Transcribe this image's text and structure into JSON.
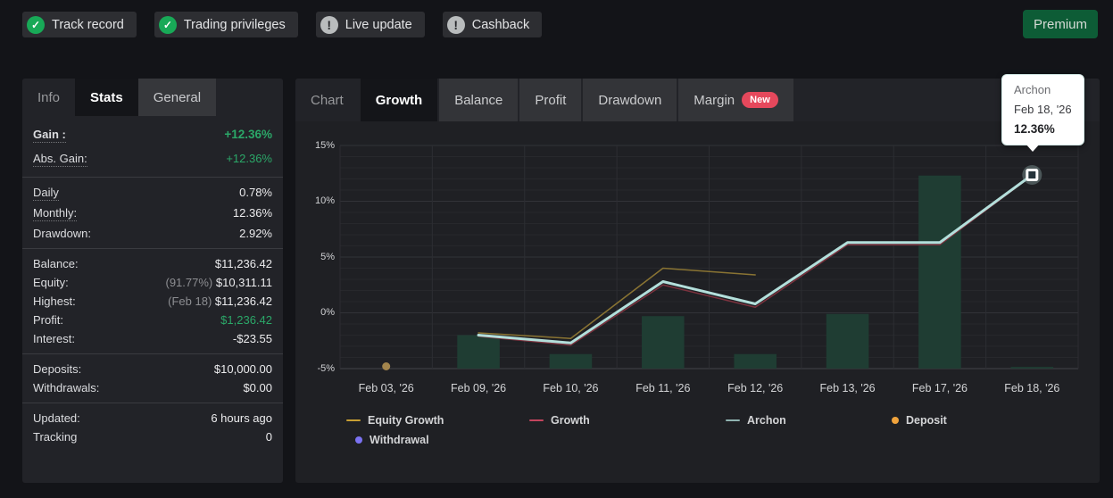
{
  "top_bar": {
    "badges": [
      {
        "label": "Track record",
        "icon": "check",
        "color": "#18a957"
      },
      {
        "label": "Trading privileges",
        "icon": "check",
        "color": "#18a957"
      },
      {
        "label": "Live update",
        "icon": "exclamation",
        "color": "#b9bcbd"
      },
      {
        "label": "Cashback",
        "icon": "exclamation",
        "color": "#b9bcbd"
      }
    ],
    "premium_label": "Premium"
  },
  "stats_panel": {
    "tabs": [
      {
        "label": "Info",
        "active": false
      },
      {
        "label": "Stats",
        "active": true
      },
      {
        "label": "General",
        "active": false,
        "alt": true
      }
    ],
    "groups": [
      {
        "rows": [
          {
            "label": "Gain :",
            "value": "+12.36%",
            "value_class": "green-bold",
            "dotted": true,
            "bold": true
          },
          {
            "label": "Abs. Gain:",
            "value": "+12.36%",
            "value_class": "green",
            "dotted": true
          }
        ]
      },
      {
        "rows": [
          {
            "label": "Daily",
            "value": "0.78%",
            "dotted": true
          },
          {
            "label": "Monthly:",
            "value": "12.36%",
            "dotted": true
          },
          {
            "label": "Drawdown:",
            "value": "2.92%"
          }
        ]
      },
      {
        "rows": [
          {
            "label": "Balance:",
            "value": "$11,236.42"
          },
          {
            "label": "Equity:",
            "value": "$10,311.11",
            "value_prefix": "(91.77%)"
          },
          {
            "label": "Highest:",
            "value": "$11,236.42",
            "value_prefix": "(Feb 18)"
          },
          {
            "label": "Profit:",
            "value": "$1,236.42",
            "value_class": "green"
          },
          {
            "label": "Interest:",
            "value": "-$23.55"
          }
        ]
      },
      {
        "rows": [
          {
            "label": "Deposits:",
            "value": "$10,000.00"
          },
          {
            "label": "Withdrawals:",
            "value": "$0.00"
          }
        ]
      },
      {
        "rows": [
          {
            "label": "Updated:",
            "value": "6 hours ago"
          },
          {
            "label": "Tracking",
            "value": "0"
          }
        ]
      }
    ]
  },
  "chart_panel": {
    "tabs": [
      {
        "label": "Chart"
      },
      {
        "label": "Growth",
        "active": true
      },
      {
        "label": "Balance"
      },
      {
        "label": "Profit"
      },
      {
        "label": "Drawdown"
      },
      {
        "label": "Margin",
        "badge": "New"
      }
    ],
    "tooltip": {
      "title": "Archon",
      "date": "Feb 18, '26",
      "value": "12.36%"
    }
  },
  "chart_data": {
    "type": "line",
    "categories": [
      "Feb 03, '26",
      "Feb 09, '26",
      "Feb 10, '26",
      "Feb 11, '26",
      "Feb 12, '26",
      "Feb 13, '26",
      "Feb 17, '26",
      "Feb 18, '26"
    ],
    "y_ticks": [
      "15%",
      "10%",
      "5%",
      "0%",
      "-5%"
    ],
    "y_tick_values": [
      15,
      10,
      5,
      0,
      -5
    ],
    "ylim": [
      -5,
      15
    ],
    "grid": true,
    "series": [
      {
        "name": "bars",
        "type": "bar",
        "color": "#1f3d33",
        "x": [
          1,
          2,
          3,
          4,
          5,
          6,
          7
        ],
        "values": [
          -2.0,
          -3.7,
          -0.3,
          -3.7,
          -0.1,
          12.3,
          -4.85
        ]
      },
      {
        "name": "Equity Growth",
        "type": "line",
        "color": "#8a7433",
        "width": 1.5,
        "x": [
          1,
          2,
          3,
          4
        ],
        "values": [
          -1.8,
          -2.3,
          4.0,
          3.4
        ]
      },
      {
        "name": "Growth",
        "type": "line",
        "color": "#7c323e",
        "width": 1.5,
        "x": [
          1,
          2,
          3,
          4,
          5,
          6,
          7
        ],
        "values": [
          -2.1,
          -2.9,
          2.5,
          0.5,
          6.1,
          6.1,
          12.3
        ]
      },
      {
        "name": "Archon",
        "type": "line",
        "color": "#b3dfdb",
        "width": 3,
        "x": [
          1,
          2,
          3,
          4,
          5,
          6,
          7
        ],
        "values": [
          -2.0,
          -2.7,
          2.8,
          0.8,
          6.3,
          6.3,
          12.36
        ],
        "marker_last": true
      },
      {
        "name": "Deposit",
        "type": "point",
        "color": "#a3854d",
        "x": [
          0
        ],
        "values": [
          -4.8
        ]
      }
    ],
    "legend": [
      {
        "label": "Equity Growth",
        "swatch": "line",
        "color": "#c79f33"
      },
      {
        "label": "Growth",
        "swatch": "line",
        "color": "#c4455e"
      },
      {
        "label": "Archon",
        "swatch": "line",
        "color": "#8fb3b0"
      },
      {
        "label": "Deposit",
        "swatch": "dot",
        "color": "#f0a33c"
      },
      {
        "label": "Withdrawal",
        "swatch": "dot",
        "color": "#7b72f2"
      }
    ],
    "legend_position": "bottom"
  }
}
